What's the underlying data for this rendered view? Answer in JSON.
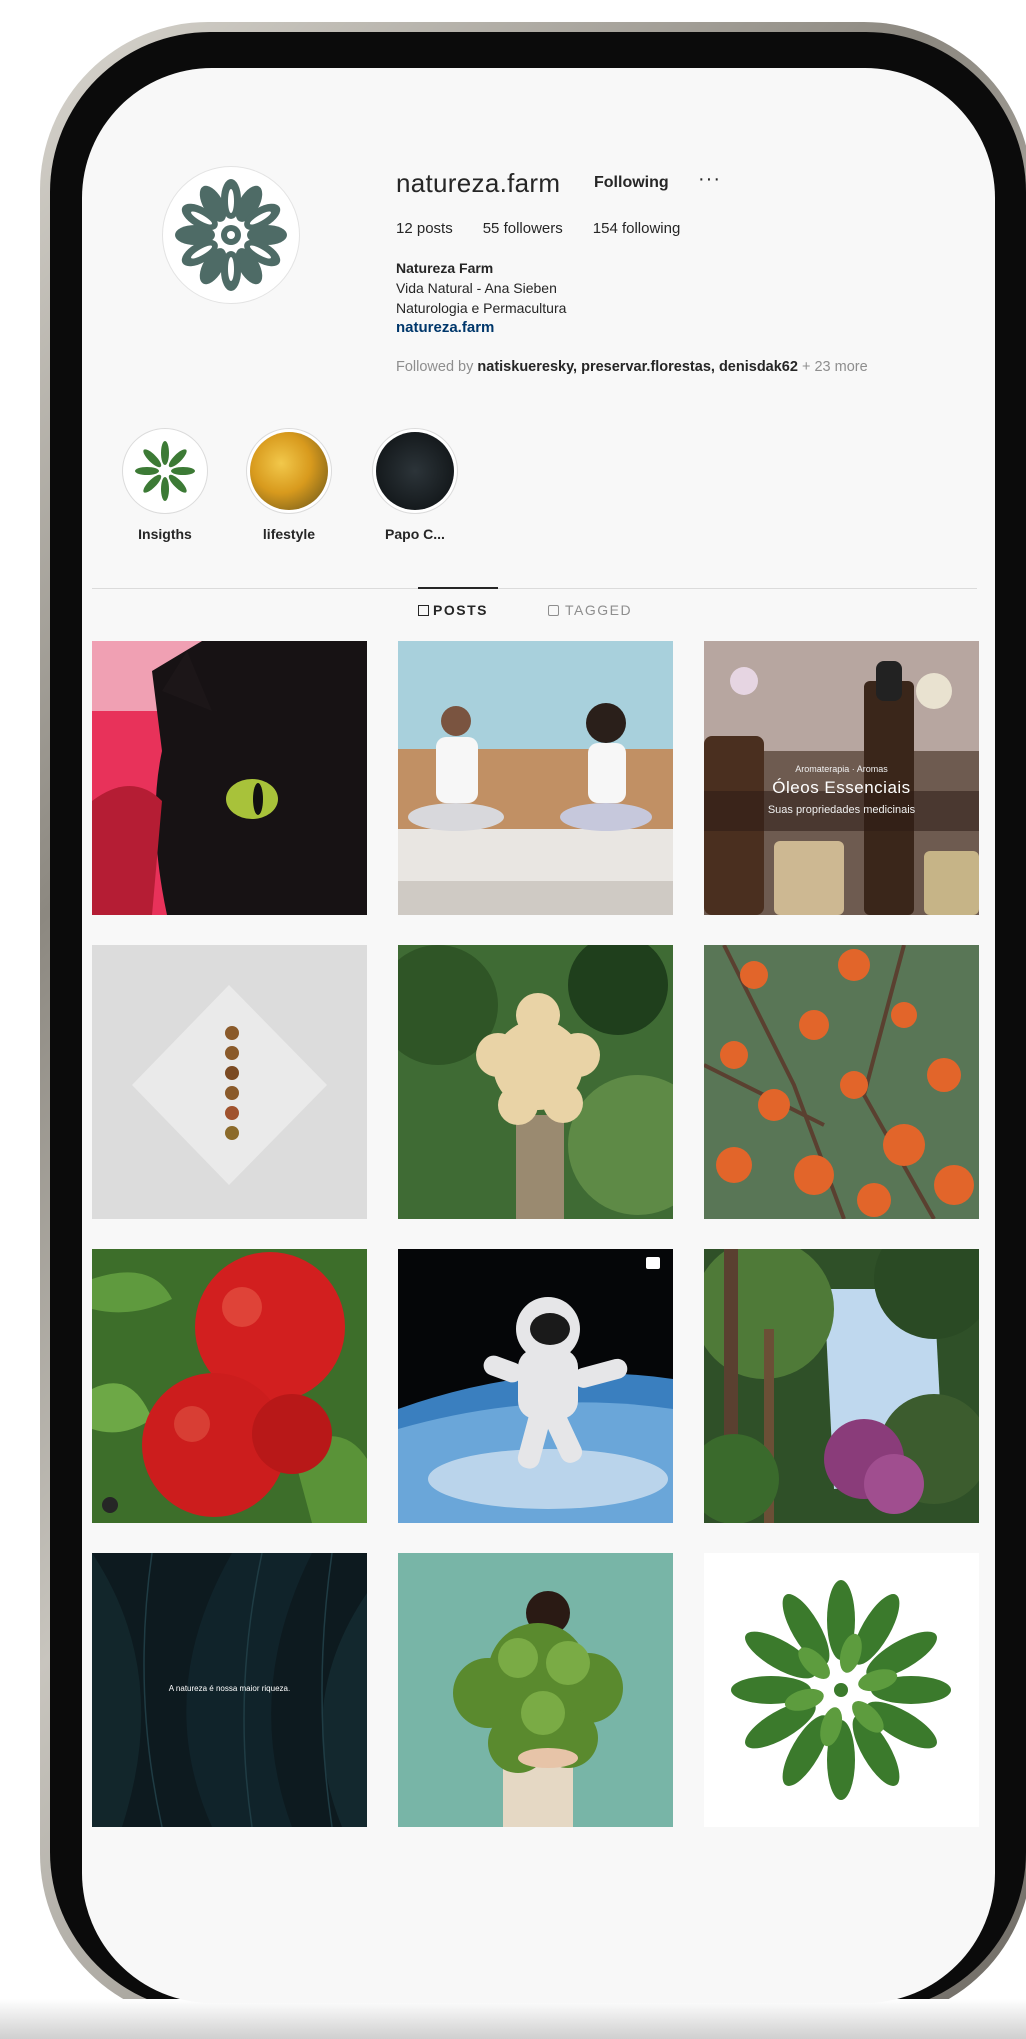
{
  "profile": {
    "username": "natureza.farm",
    "follow_label": "Following",
    "more_label": "···",
    "stats": {
      "posts": "12 posts",
      "followers": "55 followers",
      "following": "154 following"
    },
    "bio": {
      "name": "Natureza Farm",
      "line1": "Vida Natural - Ana Sieben",
      "line2": "Naturologia e Permacultura",
      "link": "natureza.farm"
    },
    "followed_by": {
      "prefix": "Followed by ",
      "names": "natiskueresky, preservar.florestas, denisdak62",
      "suffix": " + 23 more"
    }
  },
  "highlights": [
    {
      "label": "Insigths"
    },
    {
      "label": "lifestyle"
    },
    {
      "label": "Papo C..."
    }
  ],
  "tabs": {
    "posts": "POSTS",
    "tagged": "TAGGED"
  },
  "posts": {
    "oils_subtitle": "Aromaterapia · Aromas",
    "oils_title": "Óleos Essenciais",
    "oils_caption": "Suas propriedades medicinais",
    "leaves_caption": "A natureza é nossa maior riqueza."
  },
  "colors": {
    "text": "#262626",
    "secondary": "#8e8e8e",
    "link": "#00376b",
    "divider": "#dbdbdb"
  }
}
